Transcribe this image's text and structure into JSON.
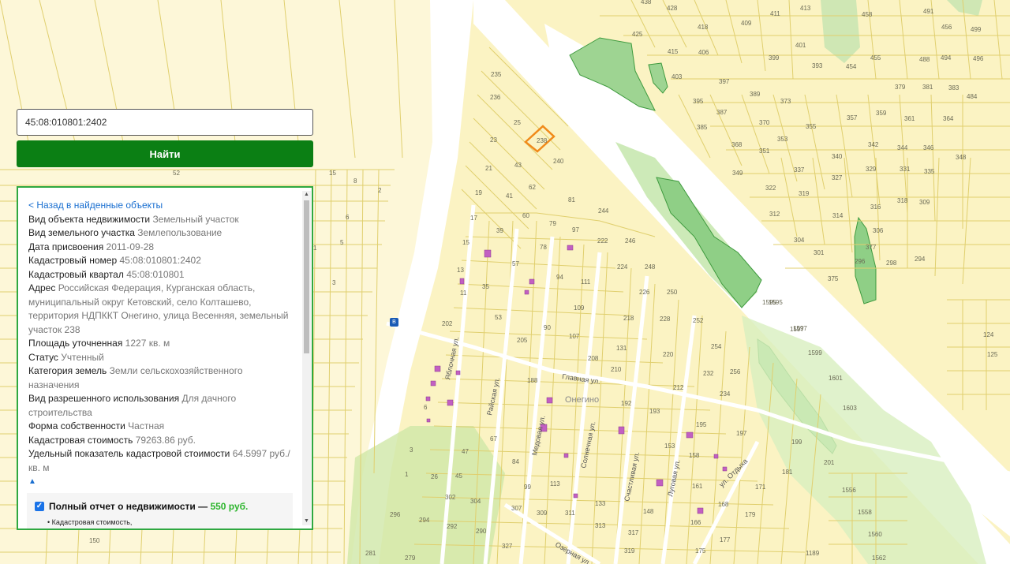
{
  "search": {
    "value": "45:08:010801:2402",
    "button_label": "Найти"
  },
  "info": {
    "back_link": "< Назад в найденные объекты",
    "rows": [
      {
        "label": "Вид объекта недвижимости",
        "value": "Земельный участок"
      },
      {
        "label": "Вид земельного участка",
        "value": "Землепользование"
      },
      {
        "label": "Дата присвоения",
        "value": "2011-09-28"
      },
      {
        "label": "Кадастровый номер",
        "value": "45:08:010801:2402"
      },
      {
        "label": "Кадастровый квартал",
        "value": "45:08:010801"
      },
      {
        "label": "Адрес",
        "value": "Российская Федерация, Курганская область, муниципальный округ Кетовский, село Колташево, территория НДПККТ Онегино, улица Весенняя, земельный участок 238"
      },
      {
        "label": "Площадь уточненная",
        "value": "1227 кв. м"
      },
      {
        "label": "Статус",
        "value": "Учтенный"
      },
      {
        "label": "Категория земель",
        "value": "Земли сельскохозяйственного назначения"
      },
      {
        "label": "Вид разрешенного использования",
        "value": "Для дачного строительства"
      },
      {
        "label": "Форма собственности",
        "value": "Частная"
      },
      {
        "label": "Кадастровая стоимость",
        "value": "79263.86 руб."
      },
      {
        "label": "Удельный показатель кадастровой стоимости",
        "value": "64.5997 руб./кв. м"
      }
    ],
    "collapse_icon": "▲",
    "report": {
      "title": "Полный отчет о недвижимости —",
      "price": "550 руб.",
      "checked": true,
      "item": "Кадастровая стоимость,"
    }
  },
  "map": {
    "colors": {
      "land": "#fbf3c3",
      "parcel_line": "#e0cf6e",
      "road": "#ffffff",
      "highlight": "#f08a1a",
      "green": "#a7d99a",
      "building": "#c25fc2"
    },
    "marker_icon": "bus-stop-icon",
    "marker_text": "B",
    "place_label": "Онегино",
    "streets": [
      "Главная ул.",
      "Яблочная ул.",
      "Райская ул.",
      "Медовая ул.",
      "Солнечная ул.",
      "Счастливая ул.",
      "Луговая ул.",
      "ул. Отдыха",
      "Озерная ул."
    ],
    "parcels": [
      "235",
      "236",
      "25",
      "238",
      "23",
      "240",
      "43",
      "21",
      "62",
      "19",
      "41",
      "81",
      "244",
      "17",
      "60",
      "79",
      "97",
      "39",
      "222",
      "246",
      "15",
      "78",
      "224",
      "248",
      "57",
      "94",
      "13",
      "111",
      "226",
      "250",
      "35",
      "109",
      "11",
      "218",
      "228",
      "252",
      "53",
      "202",
      "90",
      "107",
      "131",
      "254",
      "205",
      "210",
      "220",
      "232",
      "256",
      "208",
      "188",
      "212",
      "234",
      "192",
      "193",
      "195",
      "197",
      "199",
      "201",
      "153",
      "158",
      "148",
      "133",
      "113",
      "99",
      "84",
      "67",
      "47",
      "45",
      "26",
      "304",
      "302",
      "296",
      "294",
      "292",
      "290",
      "307",
      "309",
      "311",
      "313",
      "317",
      "319",
      "327",
      "166",
      "168",
      "175",
      "177",
      "179",
      "181",
      "161",
      "171",
      "1189",
      "1556",
      "1558",
      "1560",
      "1562",
      "1595",
      "1597",
      "1599",
      "1601",
      "1603",
      "150",
      "281",
      "279",
      "3",
      "1",
      "6",
      "52",
      "15",
      "8",
      "13",
      "6",
      "1",
      "5",
      "3",
      "2",
      "438",
      "428",
      "418",
      "409",
      "411",
      "413",
      "458",
      "491",
      "499",
      "425",
      "415",
      "406",
      "403",
      "397",
      "389",
      "399",
      "401",
      "393",
      "454",
      "455",
      "488",
      "494",
      "496",
      "395",
      "387",
      "370",
      "373",
      "355",
      "357",
      "359",
      "361",
      "364",
      "385",
      "368",
      "351",
      "353",
      "340",
      "342",
      "344",
      "346",
      "348",
      "349",
      "337",
      "327",
      "329",
      "331",
      "335",
      "322",
      "319",
      "312",
      "314",
      "316",
      "318",
      "309",
      "304",
      "306",
      "301",
      "296",
      "298",
      "294",
      "375",
      "377",
      "379",
      "381",
      "383",
      "484",
      "456",
      "124",
      "125",
      "1595",
      "1597"
    ]
  }
}
